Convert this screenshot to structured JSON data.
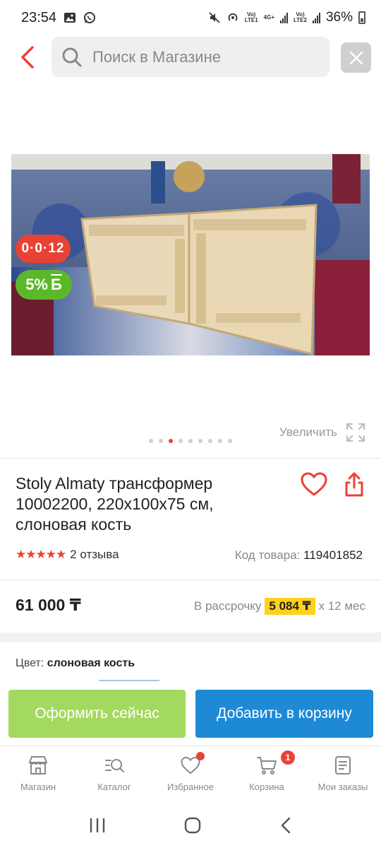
{
  "status_bar": {
    "time": "23:54",
    "battery": "36%",
    "sim1_label": "Vo)\nLTE1",
    "net_label": "4G+",
    "sim2_label": "Vo)\nLTE2"
  },
  "search": {
    "placeholder": "Поиск в Магазине"
  },
  "gallery": {
    "badge_installment": "0·0·12",
    "badge_bonus": "5%",
    "badge_bonus_symbol": "Б",
    "zoom_label": "Увеличить",
    "dot_count": 9,
    "active_dot": 2
  },
  "product": {
    "title": "Stoly Almaty трансформер 10002200, 220х100х75 см, слоновая кость",
    "stars": "★★★★★",
    "reviews": "2 отзыва",
    "code_label": "Код товара:",
    "code_value": "119401852",
    "price": "61 000 ₸",
    "installment_prefix": "В рассрочку",
    "installment_amount": "5 084 ₸",
    "installment_suffix": "х 12 мес",
    "color_label": "Цвет:",
    "color_value": "слоновая кость"
  },
  "actions": {
    "buy_now": "Оформить сейчас",
    "add_to_cart": "Добавить в корзину"
  },
  "tabbar": {
    "items": [
      {
        "label": "Магазин"
      },
      {
        "label": "Каталог"
      },
      {
        "label": "Избранное"
      },
      {
        "label": "Корзина"
      },
      {
        "label": "Мои заказы"
      }
    ],
    "cart_count": "1"
  },
  "colors": {
    "accent_red": "#e84235",
    "bonus_green": "#5bb82a",
    "buy_green": "#a3d95e",
    "cart_blue": "#1e8ad6",
    "installment_yellow": "#ffd11a"
  }
}
